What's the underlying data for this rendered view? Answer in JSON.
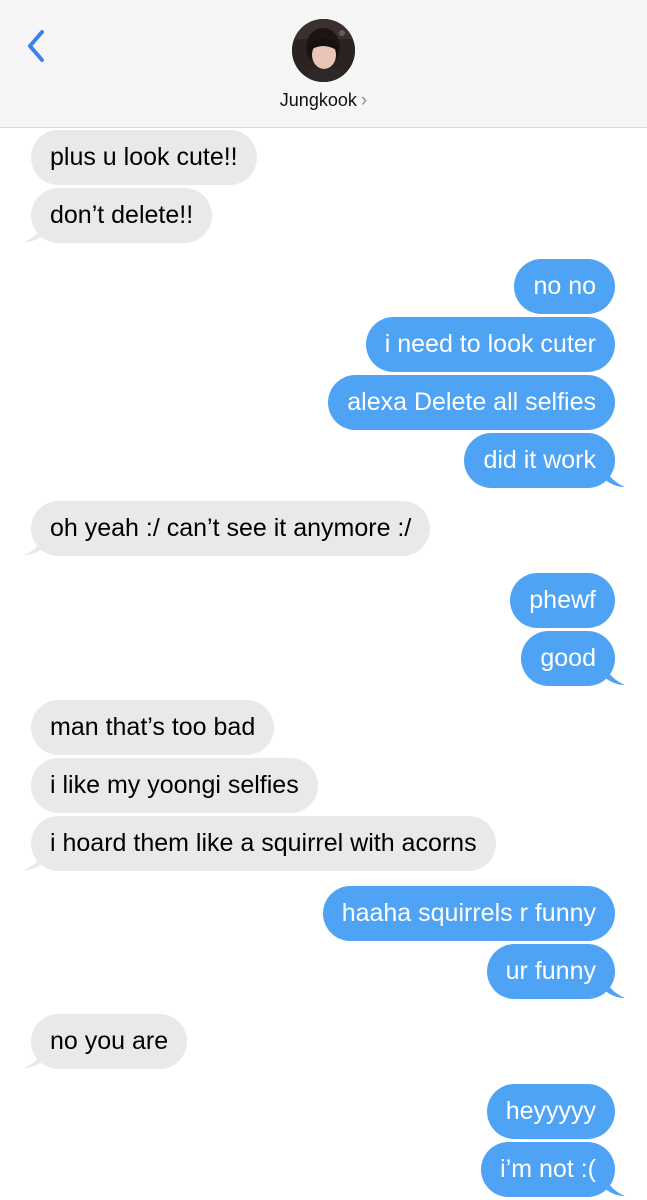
{
  "header": {
    "contact_name": "Jungkook",
    "chevron": "›",
    "back_icon": "chevron-left-icon"
  },
  "colors": {
    "incoming_bubble": "#e9e9eb",
    "outgoing_bubble": "#4fa3f5",
    "back_accent": "#3b82f0"
  },
  "messages": [
    {
      "direction": "incoming",
      "text": "plus u look cute!!"
    },
    {
      "direction": "incoming",
      "text": "don’t delete!!"
    },
    {
      "direction": "outgoing",
      "text": "no no"
    },
    {
      "direction": "outgoing",
      "text": "i need to look cuter"
    },
    {
      "direction": "outgoing",
      "text": "alexa Delete all selfies"
    },
    {
      "direction": "outgoing",
      "text": "did it work"
    },
    {
      "direction": "incoming",
      "text": "oh yeah :/ can’t see it anymore :/"
    },
    {
      "direction": "outgoing",
      "text": "phewf"
    },
    {
      "direction": "outgoing",
      "text": "good"
    },
    {
      "direction": "incoming",
      "text": "man that’s too bad"
    },
    {
      "direction": "incoming",
      "text": "i like my yoongi selfies"
    },
    {
      "direction": "incoming",
      "text": "i hoard them like a squirrel with acorns"
    },
    {
      "direction": "outgoing",
      "text": "haaha squirrels r funny"
    },
    {
      "direction": "outgoing",
      "text": "ur funny"
    },
    {
      "direction": "incoming",
      "text": "no you are"
    },
    {
      "direction": "outgoing",
      "text": "heyyyyy"
    },
    {
      "direction": "outgoing",
      "text": "i’m not :("
    }
  ]
}
